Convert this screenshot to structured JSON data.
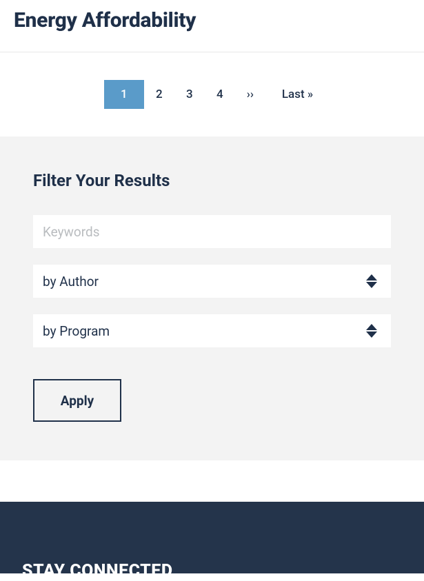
{
  "header": {
    "title": "Energy Affordability"
  },
  "pagination": {
    "items": [
      {
        "label": "1",
        "current": true
      },
      {
        "label": "2",
        "current": false
      },
      {
        "label": "3",
        "current": false
      },
      {
        "label": "4",
        "current": false
      },
      {
        "label": "››",
        "current": false
      },
      {
        "label": "Last »",
        "current": false
      }
    ]
  },
  "filter": {
    "heading": "Filter Your Results",
    "keywords_placeholder": "Keywords",
    "keywords_value": "",
    "author_select": "by Author",
    "program_select": "by Program",
    "apply_label": "Apply"
  },
  "footer": {
    "heading": "STAY CONNECTED"
  }
}
